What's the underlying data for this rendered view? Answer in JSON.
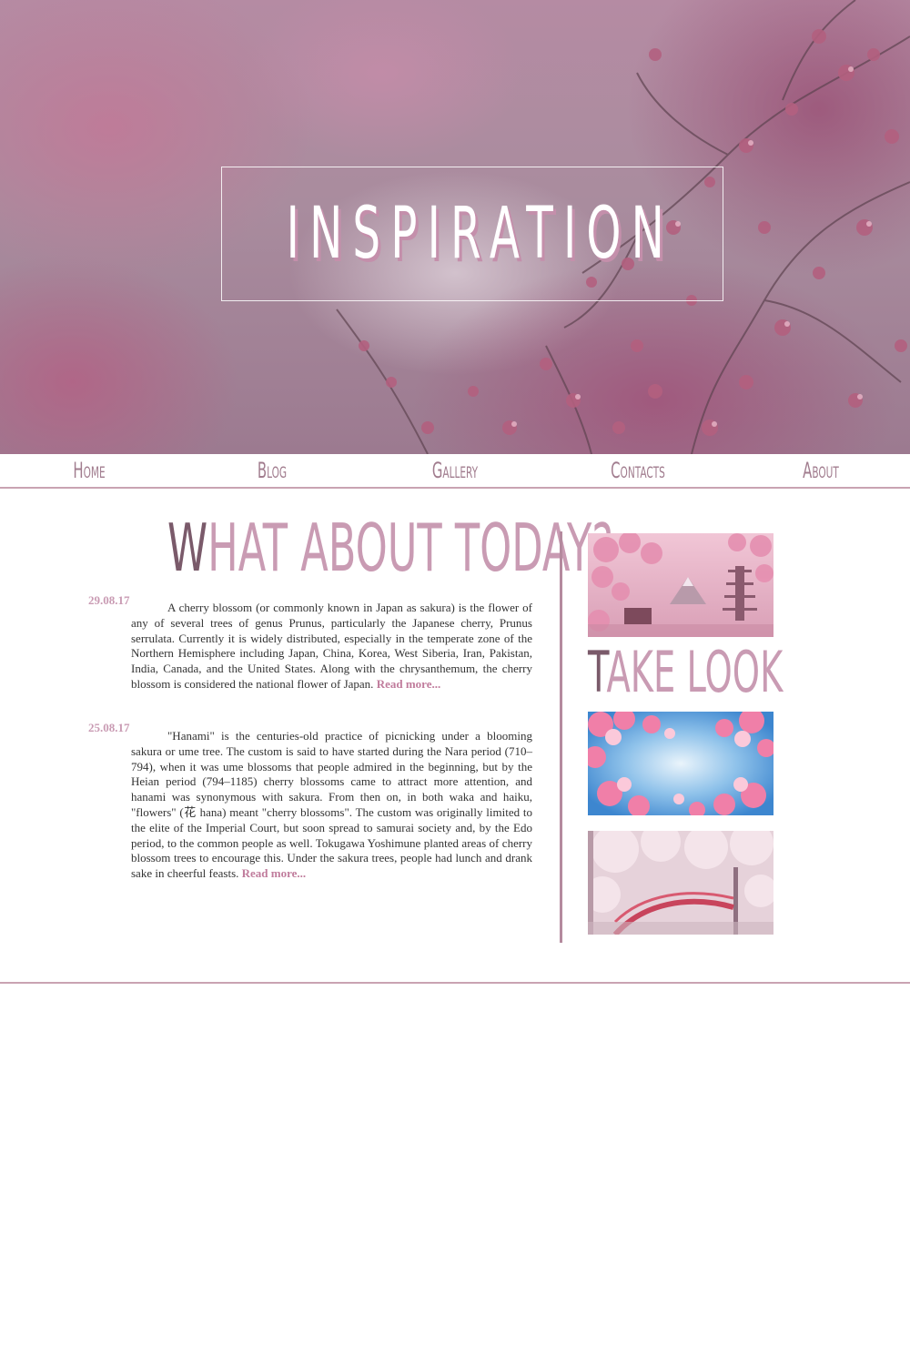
{
  "hero": {
    "title": "INSPIRATION"
  },
  "nav": {
    "items": [
      {
        "label": "Home"
      },
      {
        "label": "Blog"
      },
      {
        "label": "Gallery"
      },
      {
        "label": "Contacts"
      },
      {
        "label": "About"
      }
    ]
  },
  "main": {
    "heading_first": "W",
    "heading_rest": "HAT ABOUT TODAY?",
    "posts": [
      {
        "date": "29.08.17",
        "text": "A cherry blossom (or commonly known in Japan as sakura) is the flower of any of several trees of genus Prunus, particularly the Japanese cherry, Prunus serrulata. Currently it is widely distributed, especially in the temperate zone of the Northern Hemisphere including Japan, China, Korea, West Siberia, Iran, Pakistan, India, Canada, and the United States. Along with the chrysanthemum, the cherry blossom is considered the national flower of Japan.",
        "read_more": "Read more..."
      },
      {
        "date": "25.08.17",
        "text": "\"Hanami\" is the centuries-old practice of picnicking under a blooming sakura or ume tree. The custom is said to have started during the Nara period (710–794), when it was ume blossoms that people admired in the beginning, but by the Heian period (794–1185) cherry blossoms came to attract more attention, and hanami was synonymous with sakura. From then on, in both waka and haiku, \"flowers\" (花 hana) meant \"cherry blossoms\". The custom was originally limited to the elite of the Imperial Court, but soon spread to samurai society and, by the Edo period, to the common people as well. Tokugawa Yoshimune planted areas of cherry blossom trees to encourage this. Under the sakura trees, people had lunch and drank sake in cheerful feasts.",
        "read_more": "Read more..."
      }
    ]
  },
  "sidebar": {
    "heading_first": "T",
    "heading_rest": "AKE LOOK"
  },
  "colors": {
    "accent": "#c99bb3",
    "accent_dark": "#7a5a6a",
    "nav_text": "#a17c8e",
    "divider": "#c9a3b2",
    "link": "#c07c9c"
  },
  "icons": [
    "hero-blossom-photo",
    "pagoda-photo",
    "blossoms-sky-photo",
    "bridge-photo"
  ]
}
